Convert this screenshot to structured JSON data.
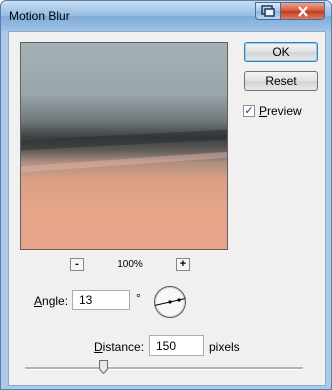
{
  "window": {
    "title": "Motion Blur"
  },
  "titlebar_buttons": {
    "help_icon": "help-icon",
    "close_icon": "close-icon"
  },
  "buttons": {
    "ok": "OK",
    "reset": "Reset"
  },
  "preview": {
    "label": "Preview",
    "checked": true
  },
  "zoom": {
    "out": "-",
    "level": "100%",
    "in": "+"
  },
  "angle": {
    "label": "Angle:",
    "value": "13",
    "unit": "°"
  },
  "distance": {
    "label": "Distance:",
    "value": "150",
    "unit": "pixels",
    "slider_fraction": 0.3
  }
}
